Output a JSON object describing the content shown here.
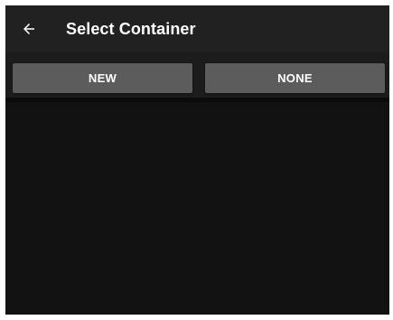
{
  "appbar": {
    "title": "Select Container",
    "back_icon": "arrow-left-icon"
  },
  "actions": {
    "new_label": "NEW",
    "none_label": "NONE"
  },
  "colors": {
    "appbar_bg": "#212121",
    "content_bg": "#121212",
    "button_bg": "#5c5c5c",
    "text": "#ffffff"
  }
}
